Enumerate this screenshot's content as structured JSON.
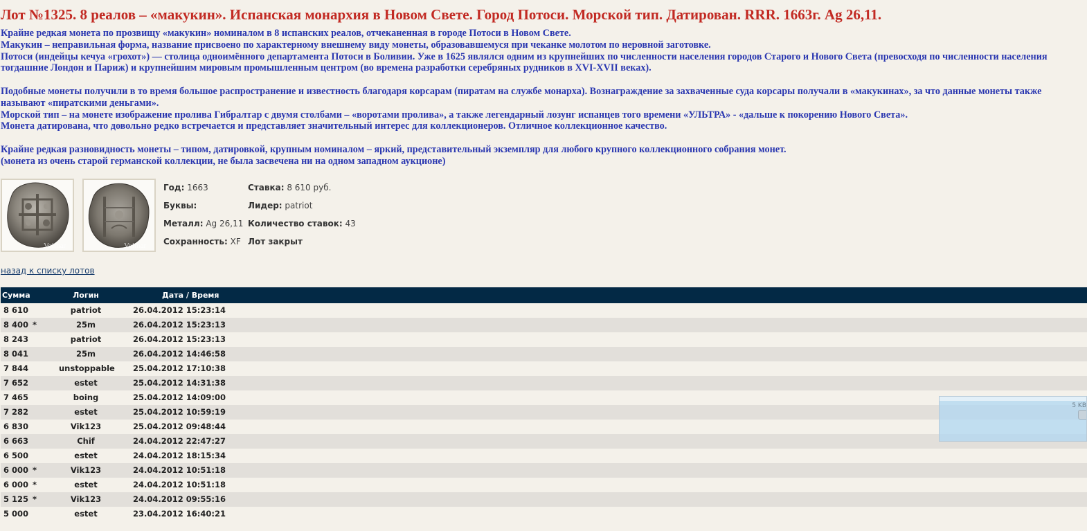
{
  "lot": {
    "title": "Лот №1325.  8 реалов – «макукин». Испанская монархия в Новом Свете. Город Потоси. Морской тип. Датирован. RRR. 1663г. Ag 26,11.",
    "description": [
      "Крайне редкая монета по прозвищу «макукин» номиналом в 8 испанских реалов, отчеканенная в городе Потоси в Новом Свете.",
      "Макукин – неправильная форма, название присвоено по характерному внешнему виду монеты, образовавшемуся при чеканке молотом по неровной заготовке.",
      "Потоси (индейцы кечуа «грохот») — столица одноимённого департамента Потоси в Боливии. Уже в 1625 являлся одним из крупнейших по численности населения городов Старого и Нового Света (превосходя по численности населения тогдашние Лондон и Париж) и крупнейшим мировым промышленным центром (во времена разработки серебряных рудников в XVI-XVII веках).",
      "",
      "Подобные монеты получили в то время большое распространение и известность благодаря корсарам (пиратам на службе монарха). Вознаграждение за захваченные суда корсары получали в «макукинах», за что данные монеты также называют «пиратскими деньгами».",
      "Морской тип – на монете изображение пролива Гибралтар с двумя столбами – «воротами пролива», а также легендарный лозунг испанцев того времени «УЛЬТРА» - «дальше к покорению Нового Света».",
      "Монета датирована, что довольно редко встречается и представляет значительный интерес для коллекционеров. Отличное коллекционное качество.",
      "",
      "Крайне редкая разновидность монеты – типом, датировкой, крупным номиналом – яркий, представительный экземпляр для любого крупного коллекционного собрания монет.",
      "(монета из очень старой германской коллекции, не была засвечена ни на одном западном аукционе)"
    ],
    "watermark": "Volmar",
    "props": {
      "year_label": "Год:",
      "year_value": "1663",
      "letters_label": "Буквы:",
      "letters_value": "",
      "metal_label": "Металл:",
      "metal_value": "Ag 26,11",
      "condition_label": "Сохранность:",
      "condition_value": "XF",
      "bid_label": "Ставка:",
      "bid_value": "8 610 руб.",
      "leader_label": "Лидер:",
      "leader_value": "patriot",
      "bids_count_label": "Количество ставок:",
      "bids_count_value": "43",
      "status": "Лот закрыт"
    },
    "back_link": "назад к списку лотов"
  },
  "bids": {
    "headers": [
      "Сумма",
      "Логин",
      "Дата / Время"
    ],
    "rows": [
      {
        "sum": "8 610",
        "star": "",
        "login": "patriot",
        "date": "26.04.2012 15:23:14"
      },
      {
        "sum": "8 400",
        "star": "*",
        "login": "25m",
        "date": "26.04.2012 15:23:13"
      },
      {
        "sum": "8 243",
        "star": "",
        "login": "patriot",
        "date": "26.04.2012 15:23:13"
      },
      {
        "sum": "8 041",
        "star": "",
        "login": "25m",
        "date": "26.04.2012 14:46:58"
      },
      {
        "sum": "7 844",
        "star": "",
        "login": "unstoppable",
        "date": "25.04.2012 17:10:38"
      },
      {
        "sum": "7 652",
        "star": "",
        "login": "estet",
        "date": "25.04.2012 14:31:38"
      },
      {
        "sum": "7 465",
        "star": "",
        "login": "boing",
        "date": "25.04.2012 14:09:00"
      },
      {
        "sum": "7 282",
        "star": "",
        "login": "estet",
        "date": "25.04.2012 10:59:19"
      },
      {
        "sum": "6 830",
        "star": "",
        "login": "Vik123",
        "date": "25.04.2012 09:48:44"
      },
      {
        "sum": "6 663",
        "star": "",
        "login": "Chif",
        "date": "24.04.2012 22:47:27"
      },
      {
        "sum": "6 500",
        "star": "",
        "login": "estet",
        "date": "24.04.2012 18:15:34"
      },
      {
        "sum": "6 000",
        "star": "*",
        "login": "Vik123",
        "date": "24.04.2012 10:51:18"
      },
      {
        "sum": "6 000",
        "star": "*",
        "login": "estet",
        "date": "24.04.2012 10:51:18"
      },
      {
        "sum": "5 125",
        "star": "*",
        "login": "Vik123",
        "date": "24.04.2012 09:55:16"
      },
      {
        "sum": "5 000",
        "star": "",
        "login": "estet",
        "date": "23.04.2012 16:40:21"
      }
    ]
  },
  "widget": {
    "size_label": "5 KB"
  },
  "colors": {
    "title": "#c22a23",
    "description": "#2a37b0",
    "table_header": "#032945",
    "row_alt": "#e2dfda",
    "background": "#f4f1ea"
  }
}
